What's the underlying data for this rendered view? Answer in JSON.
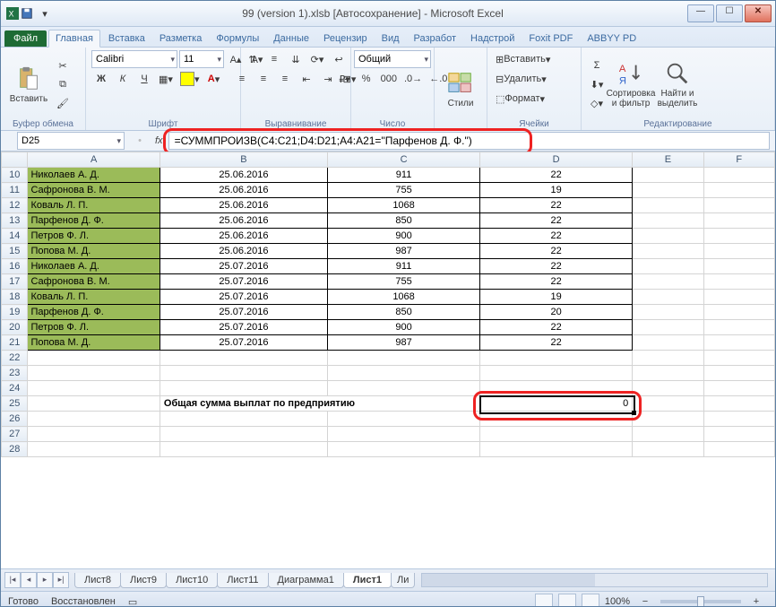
{
  "window": {
    "title": "99 (version 1).xlsb [Автосохранение] - Microsoft Excel"
  },
  "menutabs": {
    "file": "Файл",
    "items": [
      "Главная",
      "Вставка",
      "Разметка",
      "Формулы",
      "Данные",
      "Рецензир",
      "Вид",
      "Разработ",
      "Надстрой",
      "Foxit PDF",
      "ABBYY PD"
    ],
    "active": 0
  },
  "ribbon": {
    "clipboard": {
      "title": "Буфер обмена",
      "paste": "Вставить"
    },
    "font": {
      "title": "Шрифт",
      "name": "Calibri",
      "size": "11",
      "bold": "Ж",
      "italic": "К",
      "underline": "Ч"
    },
    "align": {
      "title": "Выравнивание"
    },
    "number": {
      "title": "Число",
      "format": "Общий"
    },
    "styles": {
      "title": "",
      "label": "Стили"
    },
    "cells": {
      "title": "Ячейки",
      "insert": "Вставить",
      "delete": "Удалить",
      "format": "Формат"
    },
    "editing": {
      "title": "Редактирование",
      "sigma": "Σ",
      "sort": "Сортировка\nи фильтр",
      "find": "Найти и\nвыделить"
    }
  },
  "namebox": "D25",
  "formula": "=СУММПРОИЗВ(C4:C21;D4:D21;A4:A21=\"Парфенов Д. Ф.\")",
  "columns": [
    "A",
    "B",
    "C",
    "D",
    "E",
    "F"
  ],
  "rows": [
    {
      "n": "10",
      "A": "Николаев А. Д.",
      "B": "25.06.2016",
      "C": "911",
      "D": "22"
    },
    {
      "n": "11",
      "A": "Сафронова В. М.",
      "B": "25.06.2016",
      "C": "755",
      "D": "19"
    },
    {
      "n": "12",
      "A": "Коваль Л. П.",
      "B": "25.06.2016",
      "C": "1068",
      "D": "22"
    },
    {
      "n": "13",
      "A": "Парфенов Д. Ф.",
      "B": "25.06.2016",
      "C": "850",
      "D": "22"
    },
    {
      "n": "14",
      "A": "Петров Ф. Л.",
      "B": "25.06.2016",
      "C": "900",
      "D": "22"
    },
    {
      "n": "15",
      "A": "Попова М. Д.",
      "B": "25.06.2016",
      "C": "987",
      "D": "22"
    },
    {
      "n": "16",
      "A": "Николаев А. Д.",
      "B": "25.07.2016",
      "C": "911",
      "D": "22"
    },
    {
      "n": "17",
      "A": "Сафронова В. М.",
      "B": "25.07.2016",
      "C": "755",
      "D": "22"
    },
    {
      "n": "18",
      "A": "Коваль Л. П.",
      "B": "25.07.2016",
      "C": "1068",
      "D": "19"
    },
    {
      "n": "19",
      "A": "Парфенов Д. Ф.",
      "B": "25.07.2016",
      "C": "850",
      "D": "20"
    },
    {
      "n": "20",
      "A": "Петров Ф. Л.",
      "B": "25.07.2016",
      "C": "900",
      "D": "22"
    },
    {
      "n": "21",
      "A": "Попова М. Д.",
      "B": "25.07.2016",
      "C": "987",
      "D": "22"
    }
  ],
  "blankRows": [
    "22",
    "23",
    "24"
  ],
  "row25": {
    "n": "25",
    "label": "Общая сумма выплат по предприятию",
    "value": "0"
  },
  "postRows": [
    "26",
    "27",
    "28"
  ],
  "sheets": {
    "items": [
      "Лист8",
      "Лист9",
      "Лист10",
      "Лист11",
      "Диаграмма1",
      "Лист1",
      "Ли"
    ],
    "active": 5
  },
  "status": {
    "ready": "Готово",
    "recover": "Восстановлен",
    "zoom": "100%"
  }
}
